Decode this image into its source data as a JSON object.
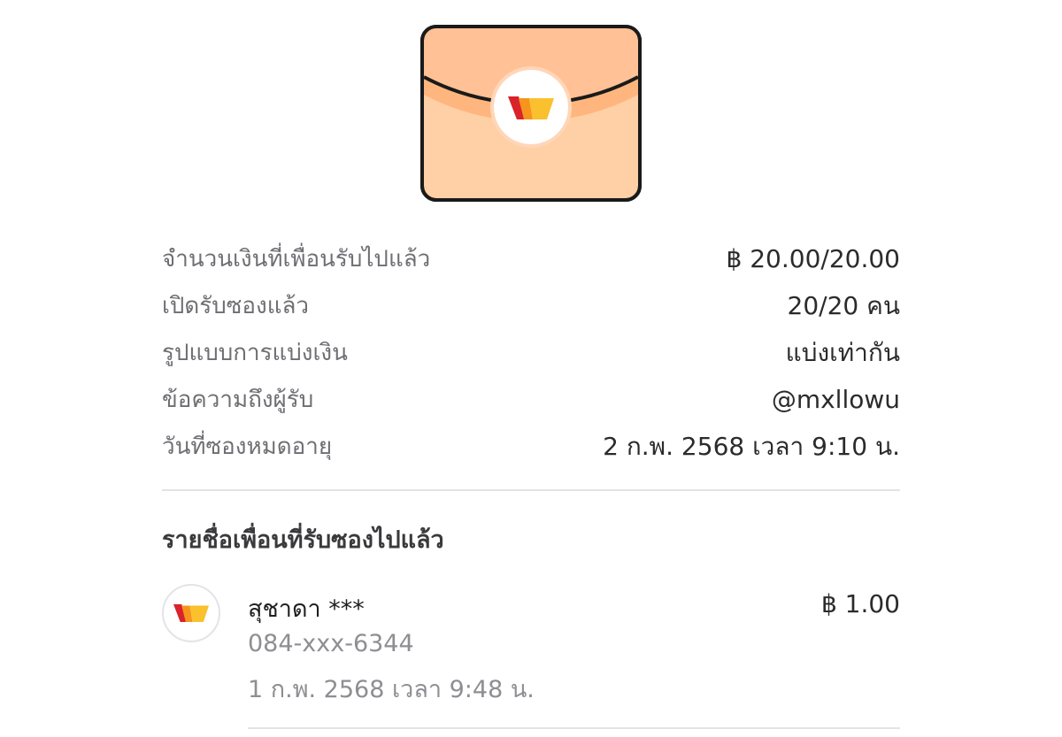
{
  "envelope": {
    "icon": "envelope-icon",
    "logo": "wallet-logo-icon",
    "colors": {
      "body": "#ffcfa6",
      "flap": "#ffc195",
      "band": "#ffb27a",
      "outline": "#1a1a1a",
      "logo_red": "#d9222a",
      "logo_orange": "#f7941d",
      "logo_yellow": "#fbc02d"
    }
  },
  "summary": {
    "rows": [
      {
        "label": "จำนวนเงินที่เพื่อนรับไปแล้ว",
        "value": "฿ 20.00/20.00"
      },
      {
        "label": "เปิดรับซองแล้ว",
        "value": "20/20 คน"
      },
      {
        "label": "รูปแบบการแบ่งเงิน",
        "value": "แบ่งเท่ากัน"
      },
      {
        "label": "ข้อความถึงผู้รับ",
        "value": "@mxllowu"
      },
      {
        "label": "วันที่ซองหมดอายุ",
        "value": "2 ก.พ. 2568 เวลา 9:10 น."
      }
    ]
  },
  "recipients_section": {
    "title": "รายชื่อเพื่อนที่รับซองไปแล้ว",
    "items": [
      {
        "name": "สุชาดา ***",
        "phone": "084-xxx-6344",
        "time": "1 ก.พ. 2568 เวลา 9:48 น.",
        "amount": "฿ 1.00"
      }
    ]
  }
}
